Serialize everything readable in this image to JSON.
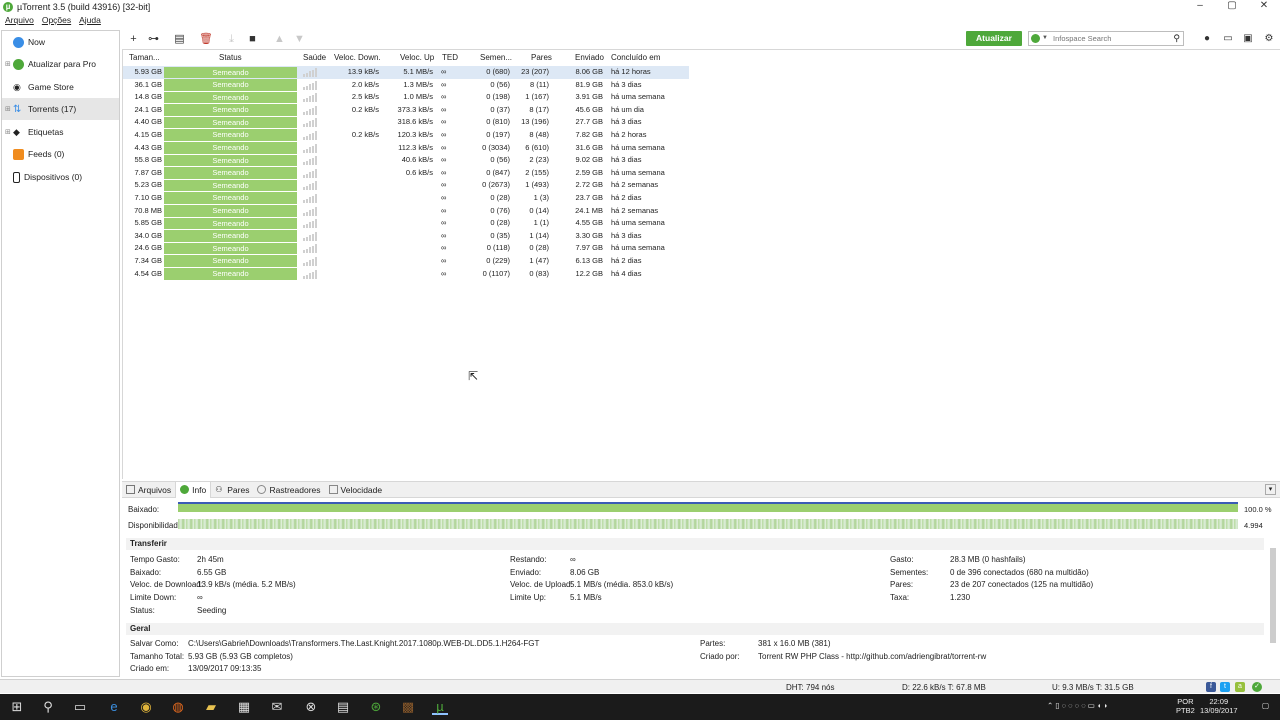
{
  "window": {
    "title": "µTorrent 3.5  (build 43916) [32-bit]"
  },
  "menu": [
    "Arquivo",
    "Opções",
    "Ajuda"
  ],
  "sidebar": [
    {
      "label": "Now",
      "icon": "now-icon",
      "expandable": false
    },
    {
      "label": "Atualizar para Pro",
      "icon": "utorrent-pro-icon",
      "expandable": true
    },
    {
      "label": "Game Store",
      "icon": "gamepad-icon",
      "expandable": false
    },
    {
      "label": "Torrents (17)",
      "icon": "torrents-icon",
      "expandable": true,
      "selected": true
    },
    {
      "label": "Etiquetas",
      "icon": "tag-icon",
      "expandable": true
    },
    {
      "label": "Feeds (0)",
      "icon": "rss-icon",
      "expandable": false
    },
    {
      "label": "Dispositivos (0)",
      "icon": "device-icon",
      "expandable": false
    }
  ],
  "toolbar": {
    "update_label": "Atualizar",
    "search_placeholder": "Infospace Search"
  },
  "columns": [
    "Taman...",
    "Status",
    "Saúde",
    "Veloc. Down.",
    "Veloc. Up",
    "TED",
    "Semen...",
    "Pares",
    "Enviado",
    "Concluído em"
  ],
  "torrents": [
    {
      "size": "5.93 GB",
      "status": "Semeando",
      "down": "13.9 kB/s",
      "up": "5.1 MB/s",
      "eta": "∞",
      "seeds": "0 (680)",
      "peers": "23 (207)",
      "sent": "8.06 GB",
      "completed": "há 12 horas",
      "selected": true
    },
    {
      "size": "36.1 GB",
      "status": "Semeando",
      "down": "2.0 kB/s",
      "up": "1.3 MB/s",
      "eta": "∞",
      "seeds": "0 (56)",
      "peers": "8 (11)",
      "sent": "81.9 GB",
      "completed": "há 3 dias"
    },
    {
      "size": "14.8 GB",
      "status": "Semeando",
      "down": "2.5 kB/s",
      "up": "1.0 MB/s",
      "eta": "∞",
      "seeds": "0 (198)",
      "peers": "1 (167)",
      "sent": "3.91 GB",
      "completed": "há uma semana"
    },
    {
      "size": "24.1 GB",
      "status": "Semeando",
      "down": "0.2 kB/s",
      "up": "373.3 kB/s",
      "eta": "∞",
      "seeds": "0 (37)",
      "peers": "8 (17)",
      "sent": "45.6 GB",
      "completed": "há um dia"
    },
    {
      "size": "4.40 GB",
      "status": "Semeando",
      "down": "",
      "up": "318.6 kB/s",
      "eta": "∞",
      "seeds": "0 (810)",
      "peers": "13 (196)",
      "sent": "27.7 GB",
      "completed": "há 3 dias"
    },
    {
      "size": "4.15 GB",
      "status": "Semeando",
      "down": "0.2 kB/s",
      "up": "120.3 kB/s",
      "eta": "∞",
      "seeds": "0 (197)",
      "peers": "8 (48)",
      "sent": "7.82 GB",
      "completed": "há 2 horas"
    },
    {
      "size": "4.43 GB",
      "status": "Semeando",
      "down": "",
      "up": "112.3 kB/s",
      "eta": "∞",
      "seeds": "0 (3034)",
      "peers": "6 (610)",
      "sent": "31.6 GB",
      "completed": "há uma semana"
    },
    {
      "size": "55.8 GB",
      "status": "Semeando",
      "down": "",
      "up": "40.6 kB/s",
      "eta": "∞",
      "seeds": "0 (56)",
      "peers": "2 (23)",
      "sent": "9.02 GB",
      "completed": "há 3 dias"
    },
    {
      "size": "7.87 GB",
      "status": "Semeando",
      "down": "",
      "up": "0.6 kB/s",
      "eta": "∞",
      "seeds": "0 (847)",
      "peers": "2 (155)",
      "sent": "2.59 GB",
      "completed": "há uma semana"
    },
    {
      "size": "5.23 GB",
      "status": "Semeando",
      "down": "",
      "up": "",
      "eta": "∞",
      "seeds": "0 (2673)",
      "peers": "1 (493)",
      "sent": "2.72 GB",
      "completed": "há 2 semanas"
    },
    {
      "size": "7.10 GB",
      "status": "Semeando",
      "down": "",
      "up": "",
      "eta": "∞",
      "seeds": "0 (28)",
      "peers": "1 (3)",
      "sent": "23.7 GB",
      "completed": "há 2 dias"
    },
    {
      "size": "70.8 MB",
      "status": "Semeando",
      "down": "",
      "up": "",
      "eta": "∞",
      "seeds": "0 (76)",
      "peers": "0 (14)",
      "sent": "24.1 MB",
      "completed": "há 2 semanas"
    },
    {
      "size": "5.85 GB",
      "status": "Semeando",
      "down": "",
      "up": "",
      "eta": "∞",
      "seeds": "0 (28)",
      "peers": "1 (1)",
      "sent": "4.55 GB",
      "completed": "há uma semana"
    },
    {
      "size": "34.0 GB",
      "status": "Semeando",
      "down": "",
      "up": "",
      "eta": "∞",
      "seeds": "0 (35)",
      "peers": "1 (14)",
      "sent": "3.30 GB",
      "completed": "há 3 dias"
    },
    {
      "size": "24.6 GB",
      "status": "Semeando",
      "down": "",
      "up": "",
      "eta": "∞",
      "seeds": "0 (118)",
      "peers": "0 (28)",
      "sent": "7.97 GB",
      "completed": "há uma semana"
    },
    {
      "size": "7.34 GB",
      "status": "Semeando",
      "down": "",
      "up": "",
      "eta": "∞",
      "seeds": "0 (229)",
      "peers": "1 (47)",
      "sent": "6.13 GB",
      "completed": "há 2 dias"
    },
    {
      "size": "4.54 GB",
      "status": "Semeando",
      "down": "",
      "up": "",
      "eta": "∞",
      "seeds": "0 (1107)",
      "peers": "0 (83)",
      "sent": "12.2 GB",
      "completed": "há 4 dias"
    }
  ],
  "detail_tabs": [
    "Arquivos",
    "Info",
    "Pares",
    "Rastreadores",
    "Velocidade"
  ],
  "info": {
    "downloaded_label": "Baixado:",
    "downloaded_value": "100.0 %",
    "downloaded_fraction": 1.0,
    "availability_label": "Disponibilidade:",
    "availability_value": "4.994",
    "transfer_title": "Transferir",
    "transfer": {
      "col1": [
        {
          "k": "Tempo Gasto:",
          "v": "2h 45m"
        },
        {
          "k": "Baixado:",
          "v": "6.55 GB"
        },
        {
          "k": "Veloc. de Download:",
          "v": "13.9 kB/s (média. 5.2 MB/s)"
        },
        {
          "k": "Limite Down:",
          "v": "∞"
        },
        {
          "k": "Status:",
          "v": "Seeding"
        }
      ],
      "col2": [
        {
          "k": "Restando:",
          "v": "∞"
        },
        {
          "k": "Enviado:",
          "v": "8.06 GB"
        },
        {
          "k": "Veloc. de Upload:",
          "v": "5.1 MB/s (média. 853.0 kB/s)"
        },
        {
          "k": "Limite Up:",
          "v": "5.1 MB/s"
        }
      ],
      "col3": [
        {
          "k": "Gasto:",
          "v": "28.3 MB (0 hashfails)"
        },
        {
          "k": "Sementes:",
          "v": "0 de 396 conectados (680 na multidão)"
        },
        {
          "k": "Pares:",
          "v": "23 de 207 conectados (125 na multidão)"
        },
        {
          "k": "Taxa:",
          "v": "1.230"
        }
      ]
    },
    "general_title": "Geral",
    "general": {
      "col1": [
        {
          "k": "Salvar Como:",
          "v": "C:\\Users\\Gabriel\\Downloads\\Transformers.The.Last.Knight.2017.1080p.WEB-DL.DD5.1.H264-FGT"
        },
        {
          "k": "Tamanho Total:",
          "v": "5.93 GB (5.93 GB completos)"
        },
        {
          "k": "Criado em:",
          "v": "13/09/2017 09:13:35"
        }
      ],
      "col2": [
        {
          "k": "Partes:",
          "v": "381 x 16.0 MB (381)"
        },
        {
          "k": "Criado por:",
          "v": "Torrent RW PHP Class - http://github.com/adriengibrat/torrent-rw"
        }
      ]
    }
  },
  "statusbar": {
    "dht": "DHT: 794 nós",
    "down": "D: 22.6 kB/s T: 67.8 MB",
    "up": "U: 9.3 MB/s T: 31.5 GB"
  },
  "taskbar": {
    "lang1": "POR",
    "lang2": "PTB2",
    "time": "22:09",
    "date": "13/09/2017"
  },
  "colors": {
    "brand": "#4ea83a",
    "status_seeding": "#9bcf6f",
    "selected_row": "#dde8f5"
  }
}
